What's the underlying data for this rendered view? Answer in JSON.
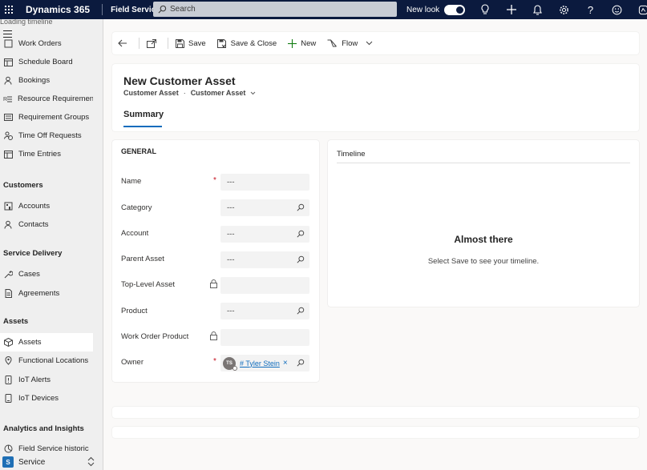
{
  "topbar": {
    "app_title": "Dynamics 365",
    "app_area": "Field Service",
    "search_placeholder": "Search",
    "new_look_label": "New look",
    "new_look_on": true,
    "icons": [
      "lightbulb-icon",
      "plus-icon",
      "bell-icon",
      "gear-icon",
      "help-icon",
      "smiley-icon",
      "copilot-icon"
    ]
  },
  "sidebar": {
    "loading_text": "Loading timeline",
    "items_top": [
      {
        "label": "Work Orders",
        "icon": "work-orders-icon"
      },
      {
        "label": "Schedule Board",
        "icon": "calendar-icon"
      },
      {
        "label": "Bookings",
        "icon": "person-icon"
      },
      {
        "label": "Resource Requirements",
        "icon": "list-icon"
      },
      {
        "label": "Requirement Groups",
        "icon": "group-icon"
      },
      {
        "label": "Time Off Requests",
        "icon": "person-clock-icon"
      },
      {
        "label": "Time Entries",
        "icon": "calendar-icon"
      }
    ],
    "groups": {
      "customers": "Customers",
      "service_delivery": "Service Delivery",
      "assets": "Assets",
      "analytics": "Analytics and Insights"
    },
    "customers": [
      {
        "label": "Accounts",
        "icon": "building-icon"
      },
      {
        "label": "Contacts",
        "icon": "person-icon"
      }
    ],
    "service_delivery": [
      {
        "label": "Cases",
        "icon": "wrench-icon"
      },
      {
        "label": "Agreements",
        "icon": "document-icon"
      }
    ],
    "assets": [
      {
        "label": "Assets",
        "icon": "box-icon",
        "active": true
      },
      {
        "label": "Functional Locations",
        "icon": "location-icon"
      },
      {
        "label": "IoT Alerts",
        "icon": "alert-icon"
      },
      {
        "label": "IoT Devices",
        "icon": "device-icon"
      }
    ],
    "analytics": [
      {
        "label": "Field Service historic",
        "icon": "chart-icon"
      }
    ],
    "area_badge": "S",
    "area_label": "Service"
  },
  "commandbar": {
    "save": "Save",
    "save_close": "Save & Close",
    "new": "New",
    "flow": "Flow"
  },
  "header": {
    "title": "New Customer Asset",
    "entity": "Customer Asset",
    "separator": "·",
    "form": "Customer Asset",
    "tab": "Summary"
  },
  "general": {
    "title": "GENERAL",
    "fields": [
      {
        "label": "Name",
        "value": "---",
        "required": true
      },
      {
        "label": "Category",
        "value": "---",
        "lookup": true
      },
      {
        "label": "Account",
        "value": "---",
        "lookup": true
      },
      {
        "label": "Parent Asset",
        "value": "---",
        "lookup": true
      },
      {
        "label": "Top-Level Asset",
        "value": "",
        "locked": true
      },
      {
        "label": "Product",
        "value": "---",
        "lookup": true
      },
      {
        "label": "Work Order Product",
        "value": "",
        "locked": true
      },
      {
        "label": "Owner",
        "required": true,
        "lookup": true
      }
    ],
    "owner": {
      "initials": "TS",
      "name": "# Tyler Stein",
      "remove": "×"
    }
  },
  "timeline": {
    "title": "Timeline",
    "heading": "Almost there",
    "message": "Select Save to see your timeline."
  },
  "colors": {
    "topbar": "#0b1a3e",
    "accent": "#0f6cbd",
    "required": "#c50f1f"
  }
}
